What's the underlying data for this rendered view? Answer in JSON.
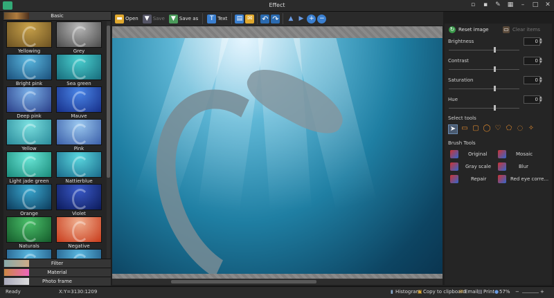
{
  "window": {
    "title": "Effect"
  },
  "left_panel": {
    "header": "Basic",
    "thumbnails": [
      {
        "label": "Yellowing",
        "color1": "#c9a24a",
        "color2": "#6b5122"
      },
      {
        "label": "Grey",
        "color1": "#b9b9b9",
        "color2": "#4a4a4a"
      },
      {
        "label": "Bright pink",
        "color1": "#5ab8e0",
        "color2": "#1a4e7a"
      },
      {
        "label": "Sea green",
        "color1": "#4ad0d0",
        "color2": "#176a7a"
      },
      {
        "label": "Deep pink",
        "color1": "#7ab0e8",
        "color2": "#2a3e88"
      },
      {
        "label": "Mauve",
        "color1": "#4a86e8",
        "color2": "#162e88"
      },
      {
        "label": "Yellow",
        "color1": "#7ae0e0",
        "color2": "#2a8a9a"
      },
      {
        "label": "Pink",
        "color1": "#9ac8f0",
        "color2": "#3a5ea8"
      },
      {
        "label": "Light jade green",
        "color1": "#6ae8d8",
        "color2": "#1a8a7a"
      },
      {
        "label": "Nattierblue",
        "color1": "#5ad8e0",
        "color2": "#1a6a8a"
      },
      {
        "label": "Orange",
        "color1": "#3aa8d0",
        "color2": "#0c3a5a"
      },
      {
        "label": "Violet",
        "color1": "#3a5ac8",
        "color2": "#0c1a5a"
      },
      {
        "label": "Naturals",
        "color1": "#4ac06a",
        "color2": "#145a2a"
      },
      {
        "label": "Negative",
        "color1": "#f0b090",
        "color2": "#c83a1a"
      },
      {
        "label": "",
        "color1": "#5ab8e0",
        "color2": "#1a4e7a"
      },
      {
        "label": "",
        "color1": "#5ab8e0",
        "color2": "#1a4e7a"
      }
    ],
    "sections": [
      "Filter",
      "Material",
      "Photo frame"
    ]
  },
  "toolbar": {
    "open": "Open",
    "save": "Save",
    "save_as": "Save as",
    "text": "Text"
  },
  "right_panel": {
    "reset_image": "Reset image",
    "clear_items": "Clear items",
    "adjustments": [
      {
        "label": "Brightness",
        "value": "0"
      },
      {
        "label": "Contrast",
        "value": "0"
      },
      {
        "label": "Saturation",
        "value": "0"
      },
      {
        "label": "Hue",
        "value": "0"
      }
    ],
    "select_tools_label": "Select tools",
    "brush_tools_label": "Brush Tools",
    "brush_tools": [
      "Original",
      "Mosaic",
      "Gray scale",
      "Blur",
      "Repair",
      "Red eye corre..."
    ]
  },
  "status": {
    "ready": "Ready",
    "coords": "X:Y=3130:1209",
    "histogram": "Histogram",
    "copy": "Copy to clipboard",
    "email": "Email",
    "print": "Print",
    "zoom": "57%"
  },
  "colors": {
    "accent": "#3a7fd0",
    "icon_orange": "#e08a2e"
  }
}
